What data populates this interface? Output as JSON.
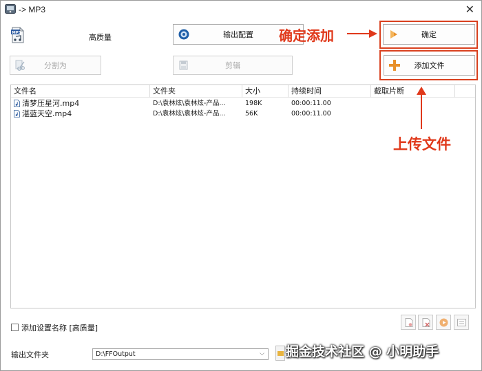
{
  "window": {
    "title": "-> MP3",
    "close_glyph": "✕"
  },
  "toolbar": {
    "profile_label": "高质量",
    "output_config_label": "输出配置",
    "confirm_label": "确定",
    "split_label": "分割为",
    "clip_label": "剪辑",
    "add_file_label": "添加文件"
  },
  "annotations": {
    "confirm_add": "确定添加",
    "upload_file": "上传文件"
  },
  "table": {
    "columns": [
      "文件名",
      "文件夹",
      "大小",
      "持续时间",
      "截取片断"
    ],
    "rows": [
      {
        "name": "清梦压星河.mp4",
        "folder": "D:\\袁林炫\\袁林炫-产品...",
        "size": "198K",
        "duration": "00:00:11.00",
        "clip": ""
      },
      {
        "name": "湛蓝天空.mp4",
        "folder": "D:\\袁林炫\\袁林炫-产品...",
        "size": "56K",
        "duration": "00:00:11.00",
        "clip": ""
      }
    ]
  },
  "bottom": {
    "add_setting_name_label": "添加设置名称 [高质量]",
    "output_folder_label": "输出文件夹",
    "output_folder_value": "D:\\FFOutput"
  },
  "watermark": "掘金技术社区 @ 小明助手",
  "colors": {
    "annotation": "#e0391b",
    "highlight_border": "#d9401e",
    "add_icon": "#e8902a"
  },
  "icons": [
    "mp3-file-icon",
    "gear-icon",
    "arrow-right-icon",
    "plus-icon",
    "scissors-icon",
    "clip-icon",
    "audio-file-icon",
    "folder-icon"
  ]
}
